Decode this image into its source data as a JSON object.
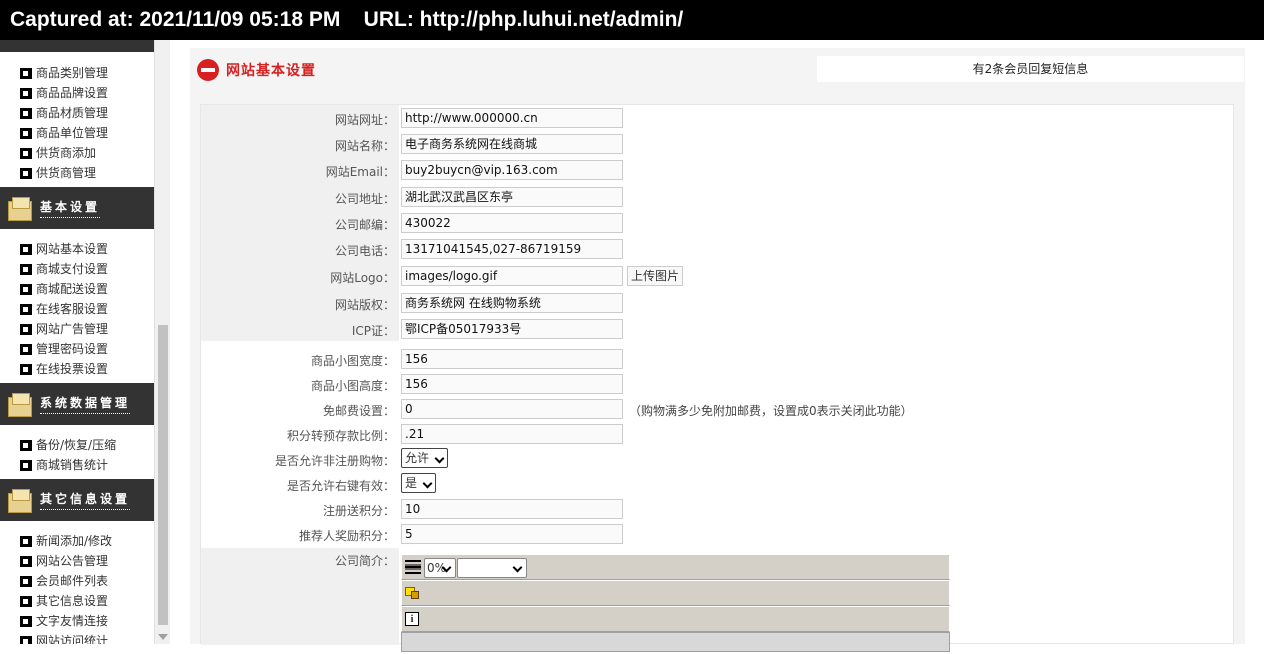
{
  "capture": {
    "label": "Captured at: 2021/11/09 05:18 PM    URL: http://php.luhui.net/admin/"
  },
  "sidebar": {
    "group_top_items": [
      "商品类别管理",
      "商品品牌设置",
      "商品材质管理",
      "商品单位管理",
      "供货商添加",
      "供货商管理"
    ],
    "basic": {
      "title": "基本设置",
      "items": [
        "网站基本设置",
        "商城支付设置",
        "商城配送设置",
        "在线客服设置",
        "网站广告管理",
        "管理密码设置",
        "在线投票设置"
      ]
    },
    "data": {
      "title": "系统数据管理",
      "items": [
        "备份/恢复/压缩",
        "商城销售统计"
      ]
    },
    "other": {
      "title": "其它信息设置",
      "items": [
        "新闻添加/修改",
        "网站公告管理",
        "会员邮件列表",
        "其它信息设置",
        "文字友情连接",
        "网站访问统计"
      ]
    }
  },
  "main": {
    "title": "网站基本设置",
    "notice": "有2条会员回复短信息"
  },
  "form": {
    "site_url": {
      "label": "网站网址：",
      "value": "http://www.000000.cn"
    },
    "site_name": {
      "label": "网站名称：",
      "value": "电子商务系统网在线商城"
    },
    "site_email": {
      "label": "网站Email：",
      "value": "buy2buycn@vip.163.com"
    },
    "company_address": {
      "label": "公司地址：",
      "value": "湖北武汉武昌区东亭"
    },
    "company_zip": {
      "label": "公司邮编：",
      "value": "430022"
    },
    "company_phone": {
      "label": "公司电话：",
      "value": "13171041545,027-86719159"
    },
    "site_logo": {
      "label": "网站Logo：",
      "value": "images/logo.gif",
      "upload_label": "上传图片"
    },
    "copyright": {
      "label": "网站版权：",
      "value": "商务系统网 在线购物系统"
    },
    "icp": {
      "label": "ICP证：",
      "value": "鄂ICP备05017933号"
    },
    "thumb_width": {
      "label": "商品小图宽度：",
      "value": "156"
    },
    "thumb_height": {
      "label": "商品小图高度：",
      "value": "156"
    },
    "free_shipping": {
      "label": "免邮费设置：",
      "value": "0",
      "hint": "（购物满多少免附加邮费，设置成0表示关闭此功能）"
    },
    "points_ratio": {
      "label": "积分转预存款比例：",
      "value": ".21"
    },
    "allow_guest": {
      "label": "是否允许非注册购物：",
      "value": "允许"
    },
    "allow_right_click": {
      "label": "是否允许右键有效：",
      "value": "是"
    },
    "register_points": {
      "label": "注册送积分：",
      "value": "10"
    },
    "referral_points": {
      "label": "推荐人奖励积分：",
      "value": "5"
    },
    "company_intro": {
      "label": "公司简介：",
      "zoom": "0%"
    }
  },
  "colors": {
    "accent_red": "#d82020",
    "sidebar_header": "#333333",
    "capture_bar": "#000000"
  }
}
